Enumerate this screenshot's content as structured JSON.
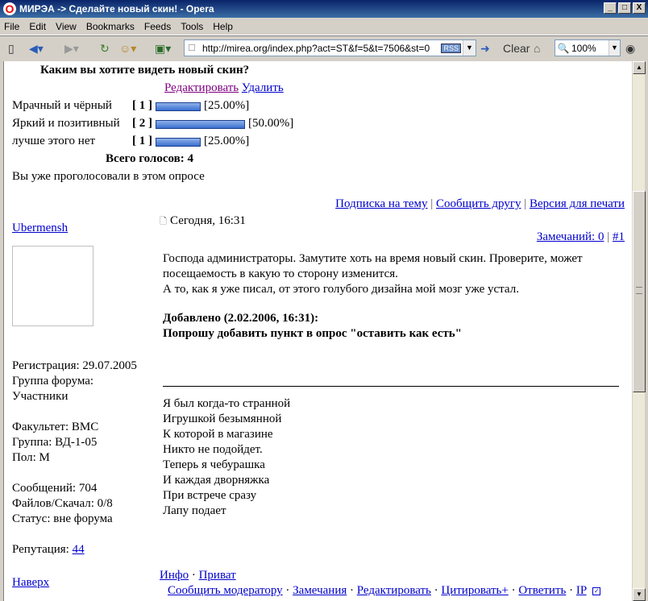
{
  "window": {
    "title": "МИРЭА -> Сделайте новый скин! - Opera",
    "min": "_",
    "max": "□",
    "close": "X"
  },
  "menu": [
    "File",
    "Edit",
    "View",
    "Bookmarks",
    "Feeds",
    "Tools",
    "Help"
  ],
  "toolbar": {
    "url": "http://mirea.org/index.php?act=ST&f=5&t=7506&st=0",
    "rss": "RSS",
    "clear": "Clear",
    "zoom": "100%"
  },
  "poll": {
    "question": "Каким вы хотите видеть новый скин?",
    "edit": "Редактировать",
    "delete": "Удалить",
    "options": [
      {
        "label": "Мрачный и чёрный",
        "count": "[ 1 ]",
        "percent": "[25.00%]",
        "fraction": 0.25
      },
      {
        "label": "Яркий и позитивный",
        "count": "[ 2 ]",
        "percent": "[50.00%]",
        "fraction": 0.5
      },
      {
        "label": "лучше этого нет",
        "count": "[ 1 ]",
        "percent": "[25.00%]",
        "fraction": 0.25
      }
    ],
    "total": "Всего голосов: 4",
    "voted": "Вы уже проголосовали в этом опросе"
  },
  "topic_links": {
    "subscribe": "Подписка на тему",
    "sep1": "|",
    "tell": "Сообщить другу",
    "sep2": "|",
    "print": "Версия для печати"
  },
  "post": {
    "author": "Ubermensh",
    "date": "Сегодня, 16:31",
    "remarks": "Замечаний: 0",
    "sep": "|",
    "num": "#1",
    "body": [
      "Господа администраторы. Замутите хоть на время новый скин. Проверите, может",
      "посещаемость в какую то сторону изменится.",
      "А то, как я уже писал, от этого голубого дизайна мой мозг уже устал."
    ],
    "added": "Добавлено (2.02.2006, 16:31):",
    "added_text": "Попрошу добавить пункт в опрос \"оставить как есть\"",
    "signature": [
      "Я был когда-то странной",
      "Игрушкой безымянной",
      "К которой в магазине",
      "Никто не подойдет.",
      "Теперь я чебурашка",
      "И каждая дворняжка",
      "При встрече сразу",
      "Лапу подает"
    ]
  },
  "profile": {
    "registration": "Регистрация: 29.07.2005",
    "group_label": "Группа форума:",
    "group": "Участники",
    "faculty": "Факультет: ВМС",
    "study_group": "Группа: ВД-1-05",
    "gender": "Пол: М",
    "messages": "Сообщений: 704",
    "files": "Файлов/Скачал: 0/8",
    "status": "Статус: вне форума",
    "reputation_label": "Репутация:",
    "reputation": "44"
  },
  "bottom": {
    "top": "Наверх",
    "info": "Инфо",
    "dot": "·",
    "private": "Приват",
    "report": "Сообщить модератору",
    "remarks": "Замечания",
    "edit": "Редактировать",
    "quote": "Цитировать+",
    "reply": "Ответить",
    "ip": "IP"
  },
  "colors": {
    "link": "#0000cc",
    "visited": "#800080",
    "bar": "#3a6fd0"
  }
}
